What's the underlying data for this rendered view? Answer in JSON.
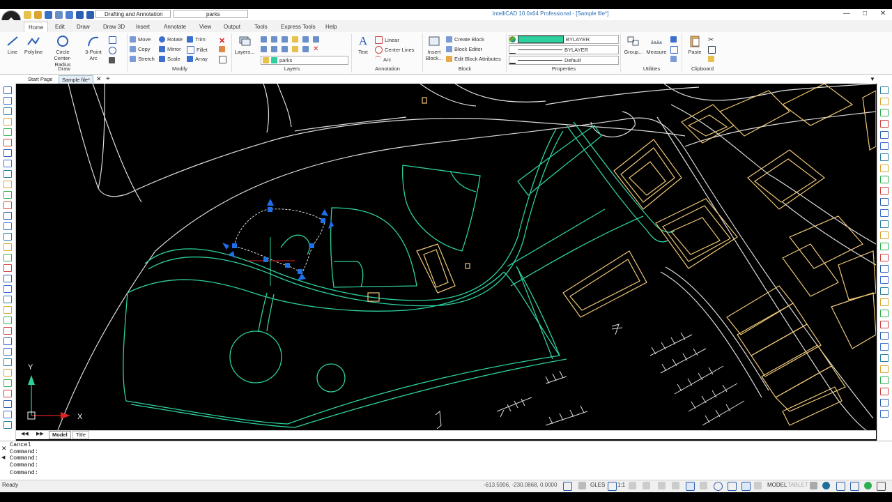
{
  "app": {
    "window_title": "IntelliCAD 10.0x64 Professional - [Sample file*]",
    "workspace": "Drafting and Annotation",
    "current_layer": "parks"
  },
  "ribbon_tabs": [
    "Home",
    "Edit",
    "Draw",
    "Draw 3D",
    "Insert",
    "Annotate",
    "View",
    "Output",
    "Tools",
    "Express Tools",
    "Help"
  ],
  "ribbon": {
    "draw": {
      "title": "Draw",
      "line": "Line",
      "polyline": "Polyline",
      "circle": "Circle",
      "circle_sub": "Center-Radius",
      "arc": "3-Point",
      "arc_sub": "Arc"
    },
    "modify": {
      "title": "Modify",
      "move": "Move",
      "copy": "Copy",
      "stretch": "Stretch",
      "rotate": "Rotate",
      "mirror": "Mirror",
      "scale": "Scale",
      "trim": "Trim",
      "fillet": "Fillet",
      "array": "Array"
    },
    "layers": {
      "title": "Layers",
      "layers_btn": "Layers...",
      "layer_value": "parks"
    },
    "annotation": {
      "title": "Annotation",
      "text": "Text",
      "linear": "Linear",
      "center_lines": "Center Lines",
      "arc": "Arc"
    },
    "block": {
      "title": "Block",
      "insert": "Insert",
      "insert_sub": "Block...",
      "create": "Create Block",
      "editor": "Block Editor",
      "edit_attr": "Edit Block Attributes"
    },
    "properties": {
      "title": "Properties",
      "color": "BYLAYER",
      "linetype": "BYLAYER",
      "lineweight": "Default"
    },
    "utilities": {
      "title": "Utilities",
      "group": "Group...",
      "measure": "Measure"
    },
    "clipboard": {
      "title": "Clipboard",
      "paste": "Paste"
    }
  },
  "doc_tabs": [
    "Start Page",
    "Sample file*"
  ],
  "layout_tabs": [
    "Model",
    "Title"
  ],
  "ucs": {
    "x": "X",
    "y": "Y"
  },
  "command_history": [
    "Cancel",
    "Command:",
    "Command:",
    "Command:"
  ],
  "command_prompt": "Command:",
  "status": {
    "ready": "Ready",
    "coords": "-613.5906, -230.0868, 0.0000",
    "gles": "GLES",
    "scale": "1:1",
    "model": "MODEL",
    "tablet": "TABLET"
  },
  "colors": {
    "parks": "#2fd0a0",
    "buildings": "#f0c878",
    "roads": "#dddddd",
    "selection": "#1e6fe8",
    "accent": "#2e6eb5"
  }
}
